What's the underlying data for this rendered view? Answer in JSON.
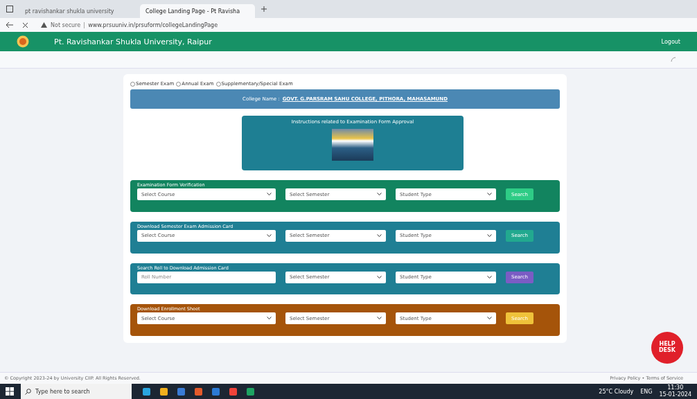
{
  "browser": {
    "tabs": [
      {
        "label": "pt ravishankar shukla university",
        "selected": false
      },
      {
        "label": "College Landing Page - Pt Ravisha",
        "selected": true
      }
    ],
    "security": "Not secure",
    "url": "www.prsuuniv.in/prsuform/collegeLandingPage"
  },
  "header": {
    "title": "Pt. Ravishankar Shukla University, Raipur",
    "logout": "Logout"
  },
  "exam_types": [
    {
      "label": "Semester Exam",
      "selected": false
    },
    {
      "label": "Annual Exam",
      "selected": false
    },
    {
      "label": "Supplementary/Special Exam",
      "selected": false
    }
  ],
  "college": {
    "label": "College Name :",
    "name": "GOVT. G.PARSRAM SAHU COLLEGE, PITHORA, MAHASAMUND"
  },
  "instructions": {
    "title": "Instructions related to Examination Form Approval"
  },
  "sections": [
    {
      "title": "Examination Form Verification",
      "color": "#12845f",
      "fields": [
        {
          "kind": "select",
          "text": "Select Course"
        },
        {
          "kind": "select",
          "text": "Select Semester"
        },
        {
          "kind": "select",
          "text": "Student Type"
        }
      ],
      "button": {
        "label": "Search",
        "color": "#2ecc86"
      }
    },
    {
      "title": "Download Semester Exam Admission Card",
      "color": "#1f7f94",
      "fields": [
        {
          "kind": "select",
          "text": "Select Course"
        },
        {
          "kind": "select",
          "text": "Select Semester"
        },
        {
          "kind": "select",
          "text": "Student Type"
        }
      ],
      "button": {
        "label": "Search",
        "color": "#22a98f"
      }
    },
    {
      "title": "Search Roll to Download Admission Card",
      "color": "#1f7f94",
      "fields": [
        {
          "kind": "input",
          "placeholder": "Roll Number"
        },
        {
          "kind": "select",
          "text": "Select Semester"
        },
        {
          "kind": "select",
          "text": "Student Type"
        }
      ],
      "button": {
        "label": "Search",
        "color": "#7b5cc4"
      }
    },
    {
      "title": "Download Enrollment Sheet",
      "color": "#a5540a",
      "fields": [
        {
          "kind": "select",
          "text": "Select Course"
        },
        {
          "kind": "select",
          "text": "Select Semester"
        },
        {
          "kind": "select",
          "text": "Student Type"
        }
      ],
      "button": {
        "label": "Search",
        "color": "#efc23a"
      }
    }
  ],
  "help_button": "HELP DESK",
  "footer": {
    "copyright": "© Copyright 2023-24 by University CIIP. All Rights Reserved.",
    "links": "Privacy Policy • Terms of Service"
  },
  "taskbar": {
    "search_placeholder": "Type here to search",
    "weather": "25°C Cloudy",
    "language": "ENG",
    "time": "11:30",
    "date": "15-01-2024"
  }
}
